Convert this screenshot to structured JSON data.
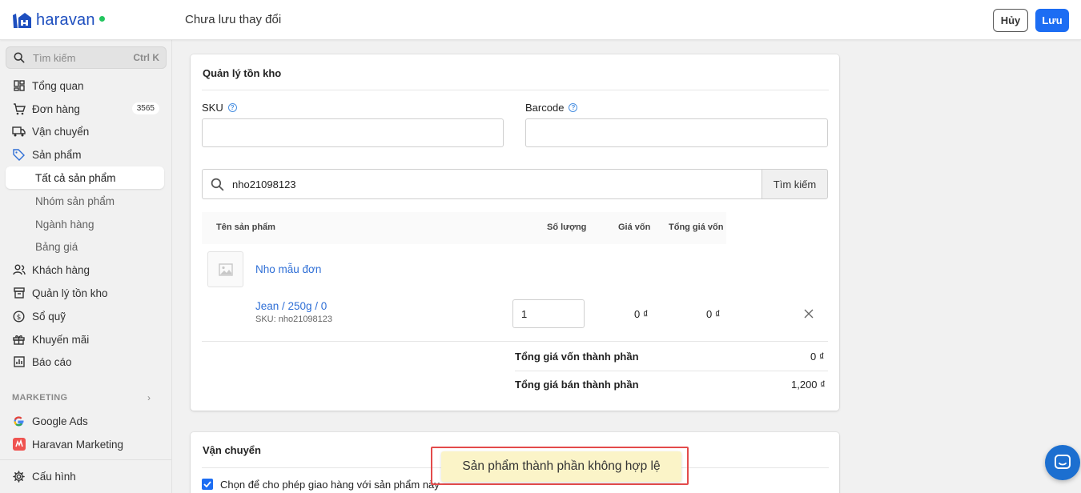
{
  "brand": {
    "name": "haravan",
    "status_color": "#22c55e",
    "accent": "#1c6df3"
  },
  "header": {
    "title": "Chưa lưu thay đổi",
    "cancel_label": "Hủy",
    "save_label": "Lưu"
  },
  "sidebar": {
    "search_placeholder": "Tìm kiếm",
    "search_shortcut": "Ctrl K",
    "items": [
      {
        "label": "Tổng quan",
        "icon": "dashboard-icon"
      },
      {
        "label": "Đơn hàng",
        "icon": "cart-icon",
        "badge": "3565"
      },
      {
        "label": "Vận chuyển",
        "icon": "truck-icon"
      },
      {
        "label": "Sản phẩm",
        "icon": "tag-icon"
      }
    ],
    "product_sub": [
      {
        "label": "Tất cả sản phẩm",
        "active": true
      },
      {
        "label": "Nhóm sản phẩm"
      },
      {
        "label": "Ngành hàng"
      },
      {
        "label": "Bảng giá"
      }
    ],
    "items2": [
      {
        "label": "Khách hàng",
        "icon": "customers-icon"
      },
      {
        "label": "Quản lý tồn kho",
        "icon": "inventory-icon"
      },
      {
        "label": "Sổ quỹ",
        "icon": "dollar-icon"
      },
      {
        "label": "Khuyến mãi",
        "icon": "gift-icon"
      },
      {
        "label": "Báo cáo",
        "icon": "report-icon"
      }
    ],
    "marketing_label": "MARKETING",
    "marketing_items": [
      {
        "label": "Google Ads",
        "icon": "google-icon"
      },
      {
        "label": "Haravan Marketing",
        "icon": "haravan-marketing-icon"
      }
    ],
    "settings_label": "Cấu hình"
  },
  "inventory": {
    "title": "Quản lý tồn kho",
    "sku_label": "SKU",
    "sku_value": "",
    "barcode_label": "Barcode",
    "barcode_value": "",
    "search_value": "nho21098123",
    "search_button": "Tìm kiếm",
    "columns": {
      "name": "Tên sản phẩm",
      "qty": "Số lượng",
      "cost": "Giá vốn",
      "total_cost": "Tổng giá vốn"
    },
    "product": {
      "name": "Nho mẫu đơn",
      "variant": "Jean / 250g / 0",
      "sku": "SKU: nho21098123",
      "qty": "1",
      "cost": "0 ₫",
      "total_cost": "0 ₫"
    },
    "totals": [
      {
        "label": "Tổng giá vốn thành phần",
        "value": "0 ₫"
      },
      {
        "label": "Tổng giá bán thành phần",
        "value": "1,200 ₫"
      }
    ]
  },
  "shipping": {
    "title": "Vận chuyển",
    "checkbox_label": "Chọn để cho phép giao hàng với sản phẩm này",
    "checked": true
  },
  "toast": {
    "message": "Sản phẩm thành phần không hợp lệ",
    "frame_color": "#e34b4b"
  }
}
